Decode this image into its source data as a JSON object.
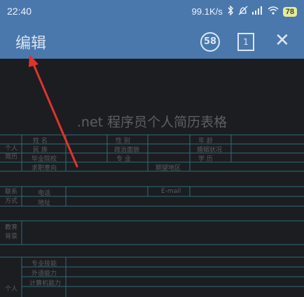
{
  "status": {
    "time": "22:40",
    "speed": "99.1K/s",
    "battery": "78"
  },
  "toolbar": {
    "edit_label": "编辑",
    "comments_count": "58",
    "pages_count": "1",
    "close_glyph": "✕"
  },
  "icons": [
    "bluetooth-icon",
    "silent-icon",
    "signal-icon",
    "wifi-icon",
    "battery-icon",
    "comment-bubble-icon",
    "page-icon",
    "close-icon"
  ],
  "doc": {
    "title": ".net 程序员个人简历表格",
    "personal": {
      "section": "个人\n简历",
      "labels": [
        "姓  名",
        "民  族",
        "毕业院校",
        "求职意向",
        "性  别",
        "政治面貌",
        "专  业",
        "期望地区",
        "年  龄",
        "婚姻状况",
        "学  历"
      ]
    },
    "contact": {
      "section": "联系\n方式",
      "labels": [
        "电话",
        "地址",
        "E-mail"
      ]
    },
    "education": {
      "section": "教育\n背景"
    },
    "skills": {
      "section": "个人",
      "labels": [
        "专业技能",
        "外语能力",
        "计算机能力"
      ]
    }
  },
  "colors": {
    "toolbar": "#4a78ad",
    "background": "#1b1d21",
    "arrow": "#e0332e",
    "grid": "#2e6d77"
  }
}
